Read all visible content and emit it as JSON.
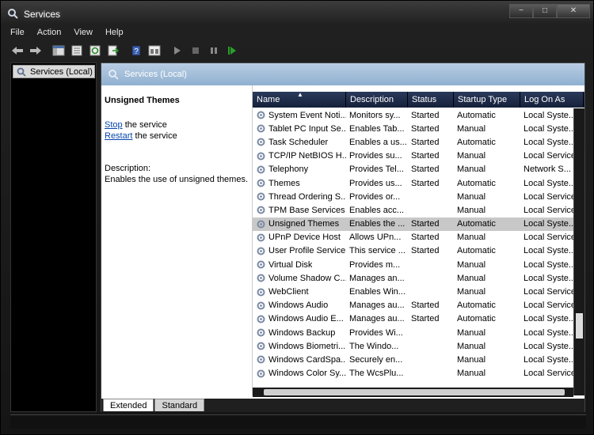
{
  "window": {
    "title": "Services",
    "controls": [
      "−",
      "□",
      "✕"
    ]
  },
  "menu": [
    "File",
    "Action",
    "View",
    "Help"
  ],
  "toolbar": {
    "icons": [
      "back-icon",
      "forward-icon",
      "console-tree-icon",
      "properties-icon",
      "refresh-icon",
      "export-icon",
      "help-icon",
      "details-icon",
      "start-icon",
      "stop-icon",
      "pause-icon",
      "restart-icon"
    ]
  },
  "tree": {
    "root_label": "Services (Local)"
  },
  "panel": {
    "header": "Services (Local)",
    "selected_title": "Unsigned Themes",
    "stop_link": "Stop",
    "stop_suffix": " the service",
    "restart_link": "Restart",
    "restart_suffix": " the service",
    "description_label": "Description:",
    "description_text": "Enables the use of unsigned themes."
  },
  "columns": [
    "Name",
    "Description",
    "Status",
    "Startup Type",
    "Log On As"
  ],
  "services": [
    {
      "name": "System Event Noti...",
      "desc": "Monitors sy...",
      "status": "Started",
      "startup": "Automatic",
      "logon": "Local Syste..."
    },
    {
      "name": "Tablet PC Input Se...",
      "desc": "Enables Tab...",
      "status": "Started",
      "startup": "Manual",
      "logon": "Local Syste..."
    },
    {
      "name": "Task Scheduler",
      "desc": "Enables a us...",
      "status": "Started",
      "startup": "Automatic",
      "logon": "Local Syste..."
    },
    {
      "name": "TCP/IP NetBIOS H...",
      "desc": "Provides su...",
      "status": "Started",
      "startup": "Manual",
      "logon": "Local Service"
    },
    {
      "name": "Telephony",
      "desc": "Provides Tel...",
      "status": "Started",
      "startup": "Manual",
      "logon": "Network S..."
    },
    {
      "name": "Themes",
      "desc": "Provides us...",
      "status": "Started",
      "startup": "Automatic",
      "logon": "Local Syste..."
    },
    {
      "name": "Thread Ordering S...",
      "desc": "Provides or...",
      "status": "",
      "startup": "Manual",
      "logon": "Local Service"
    },
    {
      "name": "TPM Base Services",
      "desc": "Enables acc...",
      "status": "",
      "startup": "Manual",
      "logon": "Local Service"
    },
    {
      "name": "Unsigned Themes",
      "desc": "Enables the ...",
      "status": "Started",
      "startup": "Automatic",
      "logon": "Local Syste...",
      "selected": true
    },
    {
      "name": "UPnP Device Host",
      "desc": "Allows UPn...",
      "status": "Started",
      "startup": "Manual",
      "logon": "Local Service"
    },
    {
      "name": "User Profile Service",
      "desc": "This service ...",
      "status": "Started",
      "startup": "Automatic",
      "logon": "Local Syste..."
    },
    {
      "name": "Virtual Disk",
      "desc": "Provides m...",
      "status": "",
      "startup": "Manual",
      "logon": "Local Syste..."
    },
    {
      "name": "Volume Shadow C...",
      "desc": "Manages an...",
      "status": "",
      "startup": "Manual",
      "logon": "Local Syste..."
    },
    {
      "name": "WebClient",
      "desc": "Enables Win...",
      "status": "",
      "startup": "Manual",
      "logon": "Local Service"
    },
    {
      "name": "Windows Audio",
      "desc": "Manages au...",
      "status": "Started",
      "startup": "Automatic",
      "logon": "Local Service"
    },
    {
      "name": "Windows Audio E...",
      "desc": "Manages au...",
      "status": "Started",
      "startup": "Automatic",
      "logon": "Local Syste..."
    },
    {
      "name": "Windows Backup",
      "desc": "Provides Wi...",
      "status": "",
      "startup": "Manual",
      "logon": "Local Syste..."
    },
    {
      "name": "Windows Biometri...",
      "desc": "The Windo...",
      "status": "",
      "startup": "Manual",
      "logon": "Local Syste..."
    },
    {
      "name": "Windows CardSpa...",
      "desc": "Securely en...",
      "status": "",
      "startup": "Manual",
      "logon": "Local Syste..."
    },
    {
      "name": "Windows Color Sy...",
      "desc": "The WcsPlu...",
      "status": "",
      "startup": "Manual",
      "logon": "Local Service"
    }
  ],
  "tabs": [
    "Extended",
    "Standard"
  ],
  "colors": {
    "header_blue": "#8fb0d0",
    "column_header": "#15203a",
    "selection": "#c8c8c8",
    "link": "#0645ad"
  }
}
